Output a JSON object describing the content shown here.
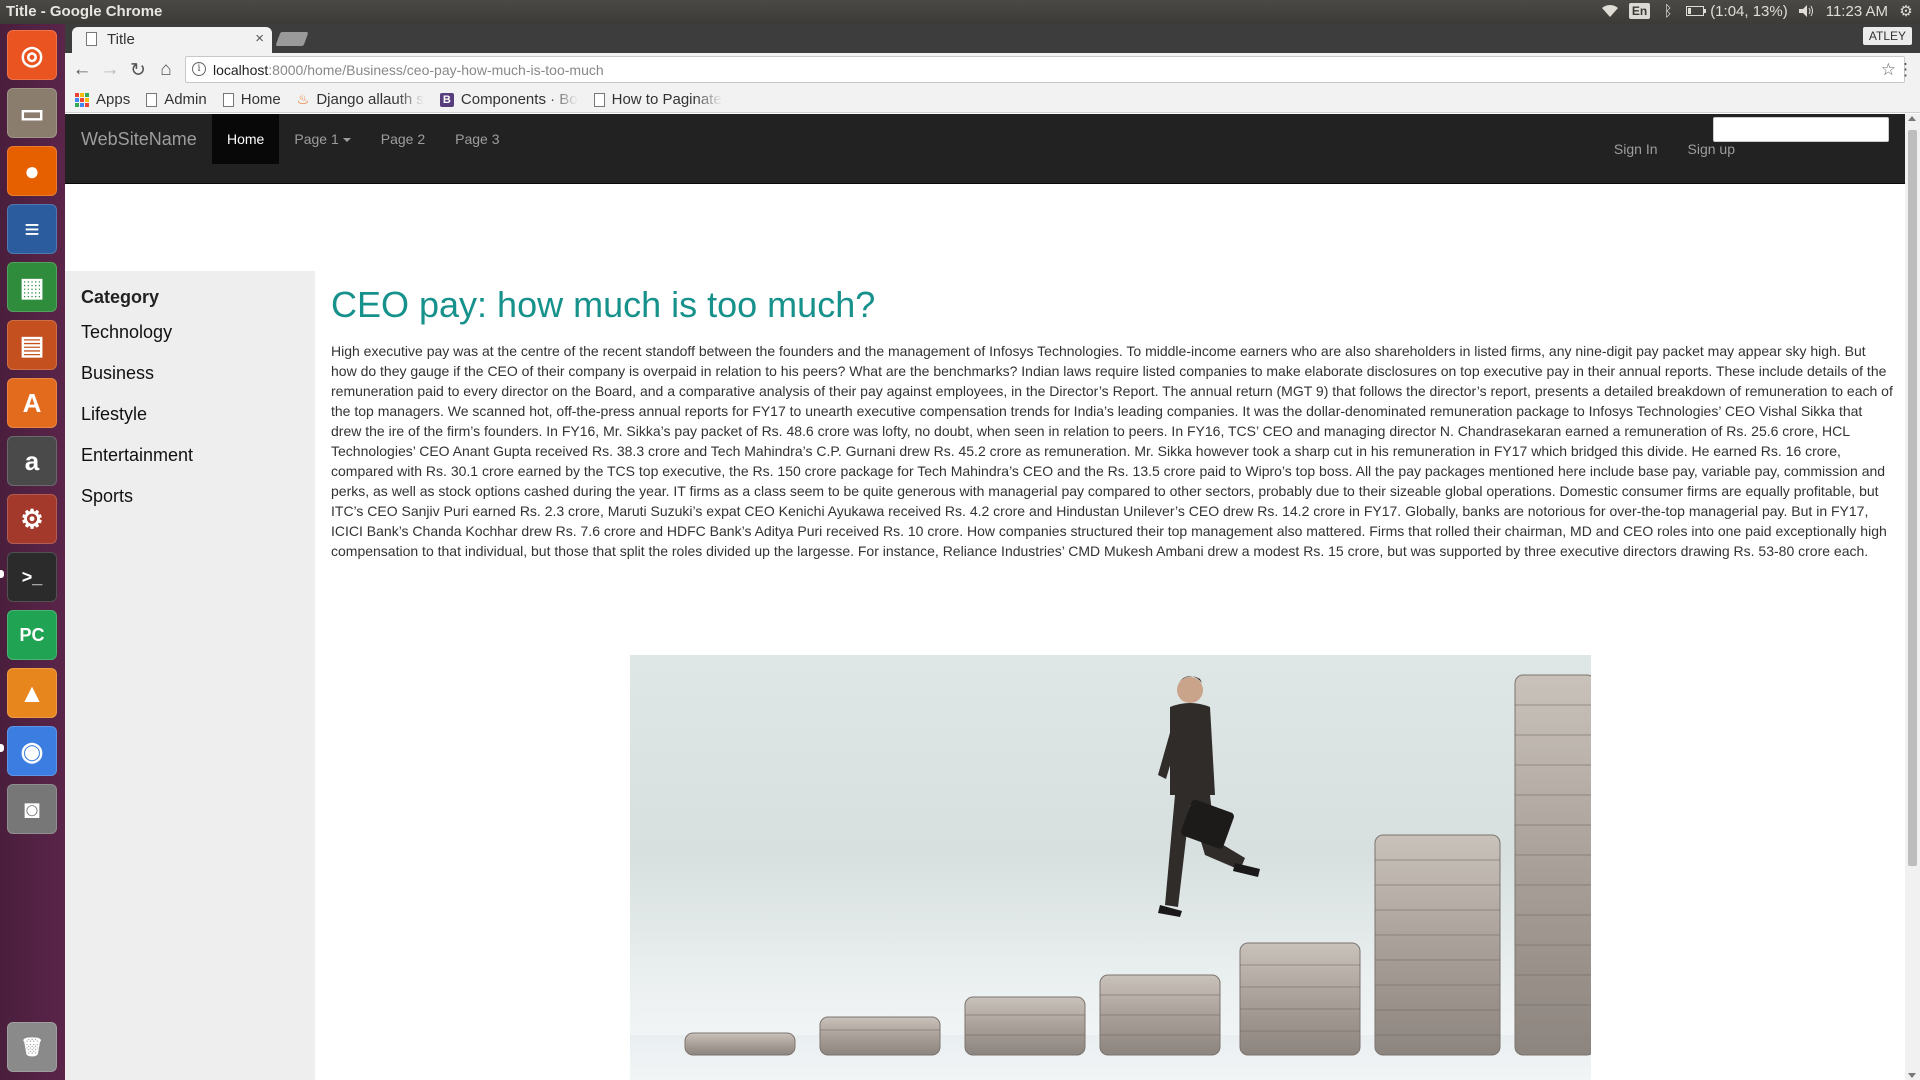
{
  "os": {
    "window_title": "Title - Google Chrome",
    "tray": {
      "keyboard_layout": "En",
      "battery": "(1:04, 13%)",
      "clock": "11:23 AM"
    },
    "launcher_items": [
      {
        "name": "ubuntu-dash-icon",
        "glyph": "◎",
        "color": "#e95420"
      },
      {
        "name": "files-icon",
        "glyph": "▭",
        "color": "#8a7d6e"
      },
      {
        "name": "firefox-icon",
        "glyph": "●",
        "color": "#e66000"
      },
      {
        "name": "libreoffice-writer-icon",
        "glyph": "≡",
        "color": "#2b5c9e"
      },
      {
        "name": "libreoffice-calc-icon",
        "glyph": "▦",
        "color": "#2f8c3c"
      },
      {
        "name": "libreoffice-impress-icon",
        "glyph": "▤",
        "color": "#c4501f"
      },
      {
        "name": "software-center-icon",
        "glyph": "A",
        "color": "#e36b1e"
      },
      {
        "name": "amazon-icon",
        "glyph": "a",
        "color": "#4a4a4a"
      },
      {
        "name": "system-settings-icon",
        "glyph": "⚙",
        "color": "#a3392b"
      },
      {
        "name": "terminal-icon",
        "glyph": ">_",
        "color": "#2b2b2b"
      },
      {
        "name": "pycharm-icon",
        "glyph": "PC",
        "color": "#21a354"
      },
      {
        "name": "vlc-icon",
        "glyph": "▲",
        "color": "#e8861e"
      },
      {
        "name": "chrome-icon",
        "glyph": "◉",
        "color": "#3b7de0"
      },
      {
        "name": "camera-icon",
        "glyph": "◙",
        "color": "#777777"
      },
      {
        "name": "trash-icon",
        "glyph": "🗑",
        "color": "#8a8a8a"
      }
    ]
  },
  "browser": {
    "tab_title": "Title",
    "tab_close": "×",
    "profile": "ATLEY",
    "url_host": "localhost",
    "url_path": ":8000/home/Business/ceo-pay-how-much-is-too-much",
    "bookmarks": [
      {
        "label": "Apps",
        "icon": "apps-grid-icon"
      },
      {
        "label": "Admin",
        "icon": "page-icon"
      },
      {
        "label": "Home",
        "icon": "page-icon"
      },
      {
        "label": "Django allauth s",
        "icon": "django-icon"
      },
      {
        "label": "Components · Bo",
        "icon": "bootstrap-icon"
      },
      {
        "label": "How to Paginate",
        "icon": "page-icon"
      }
    ]
  },
  "navbar": {
    "brand": "WebSiteName",
    "links": [
      "Home",
      "Page 1",
      "Page 2",
      "Page 3"
    ],
    "active_link": "Home",
    "sign_in": "Sign In",
    "sign_up": "Sign up",
    "search_value": ""
  },
  "sidebar": {
    "title": "Category",
    "items": [
      "Technology",
      "Business",
      "Lifestyle",
      "Entertainment",
      "Sports"
    ]
  },
  "article": {
    "title": "CEO pay: how much is too much?",
    "body": "High executive pay was at the centre of the recent standoff between the founders and the management of Infosys Technologies. To middle-income earners who are also shareholders in listed firms, any nine-digit pay packet may appear sky high. But how do they gauge if the CEO of their company is overpaid in relation to his peers? What are the benchmarks? Indian laws require listed companies to make elaborate disclosures on top executive pay in their annual reports. These include details of the remuneration paid to every director on the Board, and a comparative analysis of their pay against employees, in the Director’s Report. The annual return (MGT 9) that follows the director’s report, presents a detailed breakdown of remuneration to each of the top managers. We scanned hot, off-the-press annual reports for FY17 to unearth executive compensation trends for India’s leading companies. It was the dollar-denominated remuneration package to Infosys Technologies’ CEO Vishal Sikka that drew the ire of the firm’s founders. In FY16, Mr. Sikka’s pay packet of Rs. 48.6 crore was lofty, no doubt, when seen in relation to peers. In FY16, TCS’ CEO and managing director N. Chandrasekaran earned a remuneration of Rs. 25.6 crore, HCL Technologies’ CEO Anant Gupta received Rs. 38.3 crore and Tech Mahindra’s C.P. Gurnani drew Rs. 45.2 crore as remuneration. Mr. Sikka however took a sharp cut in his remuneration in FY17 which bridged this divide. He earned Rs. 16 crore, compared with Rs. 30.1 crore earned by the TCS top executive, the Rs. 150 crore package for Tech Mahindra’s CEO and the Rs. 13.5 crore paid to Wipro’s top boss. All the pay packages mentioned here include base pay, variable pay, commission and perks, as well as stock options cashed during the year. IT firms as a class seem to be quite generous with managerial pay compared to other sectors, probably due to their sizeable global operations. Domestic consumer firms are equally profitable, but ITC’s CEO Sanjiv Puri earned Rs. 2.3 crore, Maruti Suzuki’s expat CEO Kenichi Ayukawa received Rs. 4.2 crore and Hindustan Unilever’s CEO drew Rs. 14.2 crore in FY17. Globally, banks are notorious for over-the-top managerial pay. But in FY17, ICICI Bank’s Chanda Kochhar drew Rs. 7.6 crore and HDFC Bank’s Aditya Puri received Rs. 10 crore. How companies structured their top management also mattered. Firms that rolled their chairman, MD and CEO roles into one paid exceptionally high compensation to that individual, but those that split the roles divided up the largesse. For instance, Reliance Industries’ CMD Mukesh Ambani drew a modest Rs. 15 crore, but was supported by three executive directors drawing Rs. 53-80 crore each.",
    "image_subject": "businessman-climbing-coin-stacks-photo"
  },
  "colors": {
    "heading_teal": "#16918b",
    "navbar_bg": "#222222",
    "sidebar_bg": "#eeeeee"
  }
}
